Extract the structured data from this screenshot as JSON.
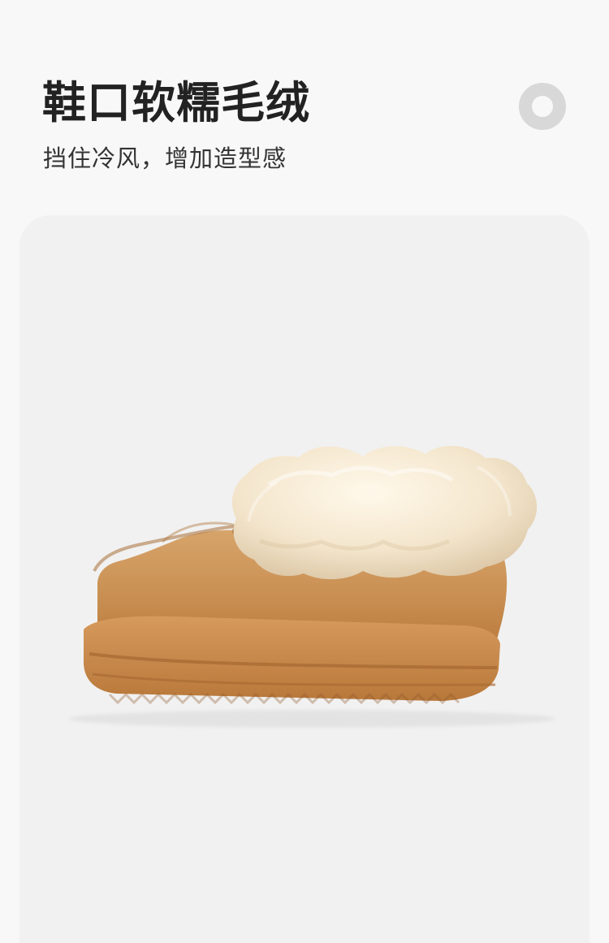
{
  "header": {
    "title": "鞋口软糯毛绒",
    "subtitle": "挡住冷风，增加造型感",
    "decoration_icon": "ring-icon"
  },
  "product": {
    "image_icon": "snow-boot-image"
  },
  "colors": {
    "page_background": "#f8f8f8",
    "card_background": "#f1f1f1",
    "text_primary": "#222222",
    "text_secondary": "#333333",
    "ring": "#d8d8d8",
    "boot_suede": "#c99356",
    "boot_fur": "#f3e5cc"
  }
}
